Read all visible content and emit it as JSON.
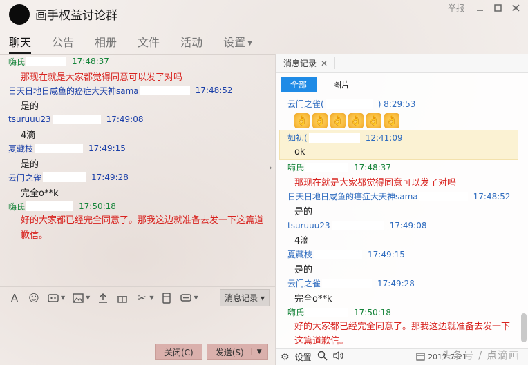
{
  "window": {
    "group_name": "画手权益讨论群",
    "report_label": "举报"
  },
  "tabs": [
    {
      "label": "聊天"
    },
    {
      "label": "公告"
    },
    {
      "label": "相册"
    },
    {
      "label": "文件"
    },
    {
      "label": "活动"
    },
    {
      "label": "设置"
    }
  ],
  "chat": {
    "messages": [
      {
        "sender": "嗨氏",
        "time": "17:48:37",
        "text": "那现在就是大家都觉得同意可以发了对吗"
      },
      {
        "sender": "日天日地日咸鱼的癌症大天神sama",
        "time": "17:48:52",
        "text": "是的"
      },
      {
        "sender": "tsuruuu23",
        "time": "17:49:08",
        "text": "4滴"
      },
      {
        "sender": "夏藏枝",
        "time": "17:49:15",
        "text": "是的"
      },
      {
        "sender": "云门之雀",
        "time": "17:49:28",
        "text": "完全o**k"
      },
      {
        "sender": "嗨氏",
        "time": "17:50:18",
        "text": "好的大家都已经完全同意了。那我这边就准备去发一下这篇道歉信。"
      }
    ]
  },
  "toolbar": {
    "history_label": "消息记录",
    "close_label": "关闭(C)",
    "send_label": "发送(S)"
  },
  "history": {
    "title": "消息记录",
    "filter_all": "全部",
    "filter_pics": "图片",
    "messages": [
      {
        "sender": "云门之雀(",
        "time": ") 8:29:53",
        "emoji_count": 6
      },
      {
        "sender": "如初(",
        "time": "12:41:09",
        "text": "ok",
        "highlight": true
      },
      {
        "sender": "嗨氏",
        "time": "17:48:37",
        "text": "那现在就是大家都觉得同意可以发了对吗"
      },
      {
        "sender": "日天日地日咸鱼的癌症大天神sama",
        "time": "17:48:52",
        "text": "是的"
      },
      {
        "sender": "tsuruuu23",
        "time": "17:49:08",
        "text": "4滴"
      },
      {
        "sender": "夏藏枝",
        "time": "17:49:15",
        "text": "是的"
      },
      {
        "sender": "云门之雀",
        "time": "17:49:28",
        "text": "完全o**k"
      },
      {
        "sender": "嗨氏",
        "time": "17:50:18",
        "text": "好的大家都已经完全同意了。那我这边就准备去发一下这篇道歉信。"
      }
    ],
    "footer": {
      "settings_label": "设置",
      "date": "2017-7-21"
    }
  },
  "watermark": "头条号 / 点滴画"
}
